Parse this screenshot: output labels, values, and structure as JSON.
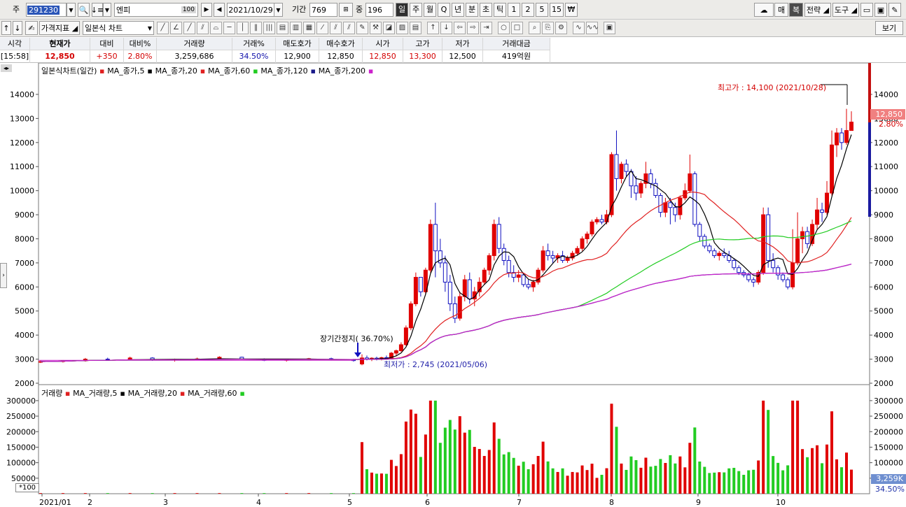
{
  "toolbar": {
    "code_label": "주",
    "code_value": "291230",
    "name_value": "엔피",
    "name_badge": "100",
    "date_value": "2021/10/29",
    "period_label": "기간",
    "period_value": "769",
    "overlap_label": "중",
    "overlap_value": "196",
    "period_buttons": [
      "일",
      "주",
      "월",
      "Q",
      "년",
      "분",
      "초",
      "틱",
      "1",
      "2",
      "5",
      "15",
      "₩"
    ],
    "right_buttons": [
      "매",
      "복",
      "전략",
      "도구"
    ],
    "indicator_label": "가격지표",
    "chart_type_value": "일본식 차트",
    "view_label": "보기"
  },
  "info": {
    "headers": [
      "시각",
      "현재가",
      "대비",
      "대비%",
      "거래량",
      "거래%",
      "매도호가",
      "매수호가",
      "시가",
      "고가",
      "저가",
      "거래대금"
    ],
    "values": [
      "[15:58]",
      "12,850",
      "+350",
      "2.80%",
      "3,259,686",
      "34.50%",
      "12,900",
      "12,850",
      "12,850",
      "13,300",
      "12,500",
      "419억원"
    ]
  },
  "price_legend": {
    "title": "일본식차트(일간)",
    "items": [
      {
        "label": "MA_종가,5",
        "color": "#e02020"
      },
      {
        "label": "MA_종가,20",
        "color": "#000000"
      },
      {
        "label": "MA_종가,60",
        "color": "#e02020"
      },
      {
        "label": "MA_종가,120",
        "color": "#22cc22"
      },
      {
        "label": "MA_종가,200",
        "color": "#1a1a8a"
      }
    ],
    "trailing_color": "#cc22cc"
  },
  "volume_legend": {
    "title": "거래량",
    "items": [
      {
        "label": "MA_거래량,5",
        "color": "#e02020"
      },
      {
        "label": "MA_거래량,20",
        "color": "#000000"
      },
      {
        "label": "MA_거래량,60",
        "color": "#e02020"
      }
    ],
    "trailing_color": "#22cc22"
  },
  "annotations": {
    "high": "최고가 : 14,100 (2021/10/28)",
    "low": "최저가 : 2,745 (2021/05/06)",
    "halt": "장기간정지( 36.70%)"
  },
  "tags": {
    "price": "12,850",
    "change_pct": "2.80%",
    "volume": "3,259K",
    "volume_pct": "34.50%",
    "scale": "*100"
  },
  "chart_data": {
    "type": "candlestick",
    "title": "일본식차트(일간)",
    "price_axis": {
      "ticks": [
        2000,
        3000,
        4000,
        5000,
        6000,
        7000,
        8000,
        9000,
        10000,
        11000,
        12000,
        13000,
        14000
      ],
      "range": [
        2000,
        14900
      ]
    },
    "volume_axis": {
      "ticks": [
        50000,
        100000,
        150000,
        200000,
        250000,
        300000
      ],
      "range": [
        0,
        320000
      ],
      "unit_note": "*100"
    },
    "x_labels": [
      "2021/01",
      "2",
      "3",
      "4",
      "5",
      "6",
      "7",
      "8",
      "9",
      "10"
    ],
    "candles": [
      [
        2880,
        2950,
        2840,
        2900
      ],
      [
        2900,
        2960,
        2860,
        2930
      ],
      [
        2930,
        3050,
        2900,
        3000
      ],
      [
        3000,
        3060,
        2950,
        2980
      ],
      [
        2980,
        3100,
        2950,
        3050
      ],
      [
        3050,
        3080,
        2930,
        2960
      ],
      [
        2960,
        3020,
        2900,
        2990
      ],
      [
        2990,
        3060,
        2950,
        3010
      ],
      [
        3010,
        3120,
        2980,
        3080
      ],
      [
        3080,
        3100,
        2980,
        3000
      ],
      [
        3000,
        3030,
        2920,
        2950
      ],
      [
        2950,
        3000,
        2900,
        2980
      ],
      [
        2980,
        3050,
        2950,
        3020
      ],
      [
        3020,
        3060,
        2960,
        2990
      ],
      [
        2990,
        3010,
        2900,
        2940
      ],
      [
        2800,
        3200,
        2745,
        3050
      ],
      [
        3050,
        3150,
        2950,
        3000
      ],
      [
        3000,
        3080,
        2920,
        3040
      ],
      [
        3040,
        3100,
        2950,
        2990
      ],
      [
        2990,
        3100,
        2950,
        3060
      ],
      [
        3060,
        3150,
        3000,
        3030
      ],
      [
        3030,
        3300,
        3000,
        3250
      ],
      [
        3250,
        3400,
        3150,
        3350
      ],
      [
        3350,
        3700,
        3300,
        3600
      ],
      [
        3600,
        4400,
        3550,
        4300
      ],
      [
        4300,
        5400,
        4200,
        5300
      ],
      [
        5300,
        6600,
        5200,
        6400
      ],
      [
        6400,
        6300,
        5600,
        5800
      ],
      [
        5800,
        6800,
        5700,
        6700
      ],
      [
        6700,
        8800,
        6600,
        8600
      ],
      [
        8600,
        9500,
        6400,
        7500
      ],
      [
        7500,
        8000,
        6800,
        7000
      ],
      [
        7000,
        7300,
        5800,
        6200
      ],
      [
        6200,
        6500,
        5000,
        5300
      ],
      [
        5300,
        5600,
        4500,
        4700
      ],
      [
        4700,
        5800,
        4600,
        5600
      ],
      [
        5600,
        6500,
        5400,
        6300
      ],
      [
        6300,
        6600,
        5300,
        5500
      ],
      [
        5500,
        6000,
        5200,
        5800
      ],
      [
        5800,
        6400,
        5600,
        6200
      ],
      [
        6200,
        6800,
        6100,
        6700
      ],
      [
        6700,
        7400,
        6500,
        7300
      ],
      [
        7300,
        8800,
        7100,
        8600
      ],
      [
        8600,
        8900,
        7400,
        7600
      ],
      [
        7600,
        7800,
        6900,
        7100
      ],
      [
        7100,
        7300,
        6400,
        6600
      ],
      [
        6600,
        6900,
        6200,
        6400
      ],
      [
        6400,
        6700,
        6200,
        6500
      ],
      [
        6500,
        6600,
        6000,
        6100
      ],
      [
        6100,
        6300,
        5900,
        6000
      ],
      [
        6000,
        6300,
        5800,
        6200
      ],
      [
        6200,
        6800,
        6100,
        6700
      ],
      [
        6700,
        7700,
        6600,
        7500
      ],
      [
        7500,
        7800,
        7100,
        7300
      ],
      [
        7300,
        7500,
        7000,
        7200
      ],
      [
        7200,
        7400,
        7000,
        7300
      ],
      [
        7300,
        7500,
        7000,
        7100
      ],
      [
        7100,
        7300,
        7000,
        7200
      ],
      [
        7200,
        7500,
        7100,
        7400
      ],
      [
        7400,
        7700,
        7300,
        7600
      ],
      [
        7600,
        8100,
        7500,
        8000
      ],
      [
        8000,
        8300,
        7800,
        8200
      ],
      [
        8200,
        8800,
        8100,
        8700
      ],
      [
        8700,
        8900,
        8600,
        8800
      ],
      [
        8800,
        9000,
        8600,
        8700
      ],
      [
        8700,
        9200,
        8600,
        9000
      ],
      [
        9000,
        11600,
        8900,
        11500
      ],
      [
        11500,
        12500,
        10000,
        10500
      ],
      [
        10500,
        11200,
        10300,
        11100
      ],
      [
        11100,
        11300,
        10600,
        10800
      ],
      [
        10800,
        10900,
        9700,
        10200
      ],
      [
        10200,
        10600,
        9600,
        9900
      ],
      [
        9900,
        10400,
        9700,
        10300
      ],
      [
        10300,
        11200,
        10100,
        10700
      ],
      [
        10700,
        10900,
        10100,
        10300
      ],
      [
        10300,
        10500,
        9700,
        9800
      ],
      [
        9800,
        9900,
        8900,
        9100
      ],
      [
        9100,
        9700,
        8900,
        9500
      ],
      [
        9500,
        9700,
        8600,
        9300
      ],
      [
        9300,
        9500,
        8700,
        9000
      ],
      [
        9000,
        9800,
        8800,
        9700
      ],
      [
        9700,
        10300,
        9600,
        10000
      ],
      [
        10000,
        11500,
        9900,
        10700
      ],
      [
        10700,
        10800,
        8500,
        8600
      ],
      [
        8600,
        8700,
        7900,
        8100
      ],
      [
        8100,
        8200,
        7600,
        7700
      ],
      [
        7700,
        7800,
        7400,
        7500
      ],
      [
        7500,
        7600,
        7200,
        7300
      ],
      [
        7300,
        7500,
        7100,
        7400
      ],
      [
        7400,
        7600,
        7200,
        7300
      ],
      [
        7300,
        7500,
        7000,
        7100
      ],
      [
        7100,
        7200,
        6700,
        6800
      ],
      [
        6800,
        6900,
        6500,
        6600
      ],
      [
        6600,
        6700,
        6400,
        6500
      ],
      [
        6500,
        6600,
        6200,
        6300
      ],
      [
        6300,
        6400,
        6000,
        6200
      ],
      [
        6200,
        6700,
        6100,
        6600
      ],
      [
        6600,
        9300,
        6500,
        9000
      ],
      [
        9000,
        9300,
        6800,
        7100
      ],
      [
        7100,
        7400,
        6600,
        6800
      ],
      [
        6800,
        6900,
        6300,
        6500
      ],
      [
        6500,
        6600,
        6200,
        6300
      ],
      [
        6300,
        6400,
        5900,
        6000
      ],
      [
        6000,
        8400,
        5900,
        7000
      ],
      [
        7000,
        9100,
        6900,
        8000
      ],
      [
        8000,
        8500,
        7400,
        8300
      ],
      [
        8300,
        8500,
        7600,
        7800
      ],
      [
        7800,
        8800,
        7700,
        8600
      ],
      [
        8600,
        9700,
        8400,
        9200
      ],
      [
        9200,
        9500,
        8700,
        9100
      ],
      [
        9100,
        10400,
        9000,
        9900
      ],
      [
        9900,
        12500,
        9800,
        11900
      ],
      [
        11900,
        12600,
        11400,
        12400
      ],
      [
        12400,
        12600,
        11700,
        12000
      ],
      [
        12000,
        13400,
        11900,
        12500
      ],
      [
        12500,
        13300,
        12500,
        12850
      ]
    ]
  }
}
